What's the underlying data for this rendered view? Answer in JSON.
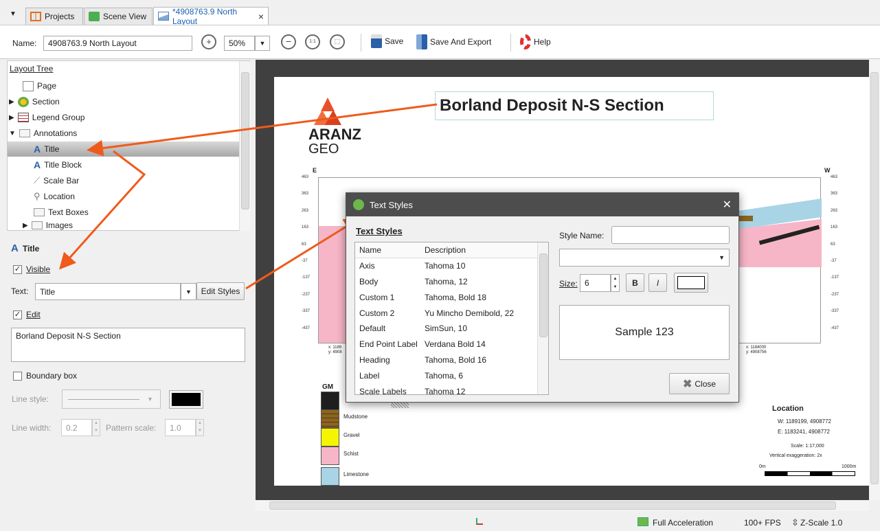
{
  "tabs": [
    {
      "label": "Projects",
      "icon": "projects-icon"
    },
    {
      "label": "Scene View",
      "icon": "scene-view-icon"
    },
    {
      "label": "*4908763.9 North Layout",
      "icon": "layout-icon",
      "close": "×"
    }
  ],
  "toolbar": {
    "name_label": "Name:",
    "name_value": "4908763.9 North Layout",
    "zoom": "50%",
    "save": "Save",
    "save_export": "Save And Export",
    "help": "Help"
  },
  "tree": {
    "header": "Layout Tree",
    "items": [
      "Page",
      "Section",
      "Legend Group",
      "Annotations",
      "Title",
      "Title Block",
      "Scale Bar",
      "Location",
      "Text Boxes",
      "Images"
    ]
  },
  "props": {
    "title": "Title",
    "visible_label": "Visible",
    "text_label": "Text:",
    "text_value": "Title",
    "edit_styles": "Edit Styles",
    "edit_label": "Edit",
    "edit_text": "Borland Deposit N-S Section",
    "boundary_label": "Boundary box",
    "line_style_label": "Line style:",
    "line_width_label": "Line width:",
    "line_width_value": "0.2",
    "pattern_scale_label": "Pattern scale:",
    "pattern_scale_value": "1.0"
  },
  "page": {
    "title": "Borland Deposit N-S Section",
    "logo_line1": "ARANZ",
    "logo_line2": "GEO",
    "east": "E",
    "west": "W",
    "yticks": [
      "463",
      "363",
      "263",
      "163",
      "63",
      "-37",
      "-137",
      "-237",
      "-337",
      "-437"
    ],
    "coord_left": "x: 1189\ny: 4908",
    "coord_right": "x: 1184000\ny: 4908756",
    "legend_title": "GM",
    "legend": [
      "Mudstone",
      "Gravel",
      "Schist",
      "Limestone"
    ],
    "location_title": "Location",
    "location_w": "W:  1189199, 4908772",
    "location_e": "E:  1183241, 4908772",
    "scale": "Scale: 1:17,000",
    "vert_exag": "Vertical exaggeration: 2x",
    "scalebar_start": "0m",
    "scalebar_end": "1000m"
  },
  "dialog": {
    "title": "Text Styles",
    "section": "Text Styles",
    "col_name": "Name",
    "col_desc": "Description",
    "rows": [
      {
        "name": "Axis",
        "desc": "Tahoma 10"
      },
      {
        "name": "Body",
        "desc": "Tahoma, 12"
      },
      {
        "name": "Custom 1",
        "desc": "Tahoma, Bold 18"
      },
      {
        "name": "Custom 2",
        "desc": "Yu Mincho Demibold, 22"
      },
      {
        "name": "Default",
        "desc": "SimSun, 10"
      },
      {
        "name": "End Point Label",
        "desc": "Verdana Bold 14"
      },
      {
        "name": "Heading",
        "desc": "Tahoma, Bold 16"
      },
      {
        "name": "Label",
        "desc": "Tahoma, 6"
      },
      {
        "name": "Scale Labels",
        "desc": "Tahoma 12"
      }
    ],
    "style_name_label": "Style Name:",
    "size_label": "Size:",
    "size_value": "6",
    "bold": "B",
    "italic": "I",
    "sample": "Sample 123",
    "close": "Close"
  },
  "status": {
    "acceleration": "Full Acceleration",
    "fps": "100+ FPS",
    "zscale": "Z-Scale 1.0"
  },
  "colors": {
    "accent": "#1a5fb4",
    "arrow": "#f05a1a",
    "mudstone": "#8b6420",
    "gravel": "#f5f500",
    "schist": "#f7b6c8",
    "limestone": "#a8d4e6"
  }
}
